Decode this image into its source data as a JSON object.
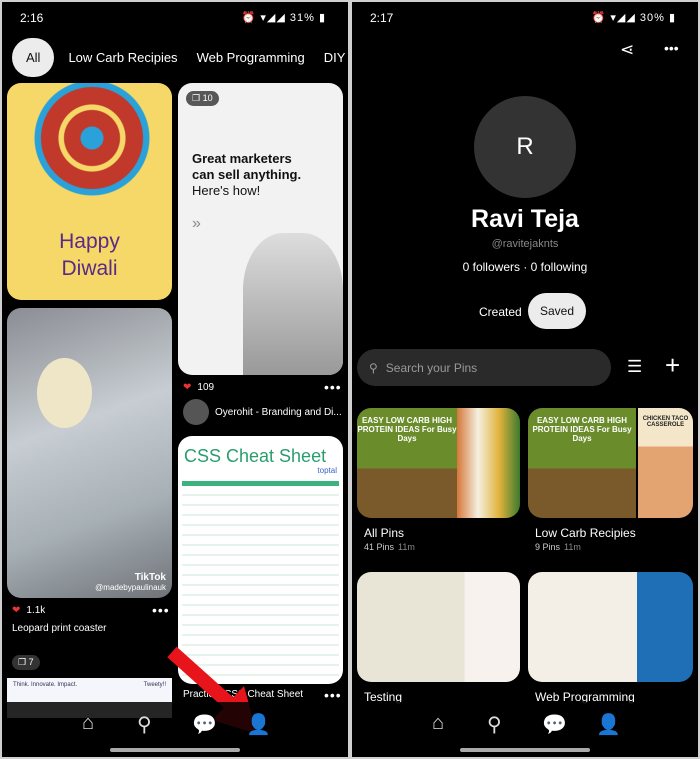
{
  "left": {
    "status": {
      "time": "2:16",
      "battery": "31%"
    },
    "chips": [
      "All",
      "Low Carb Recipies",
      "Web Programming",
      "DIY Pins"
    ],
    "pins": {
      "diwali": {
        "text1": "Happy",
        "text2": "Diwali"
      },
      "marketing": {
        "badge": "10",
        "line1": "Great marketers",
        "line2": "can sell anything.",
        "line3": "Here's how!",
        "arrows": "»",
        "likes": "109",
        "author": "Oyerohit - Branding and Di..."
      },
      "tiktok": {
        "watermark": "TikTok",
        "handle": "@madebypaulinauk",
        "likes": "1.1k",
        "title": "Leopard print coaster"
      },
      "css": {
        "title": "CSS Cheat Sheet",
        "brand": "toptal",
        "caption": "Practical CSS Cheat Sheet"
      },
      "fourth": {
        "badge": "7",
        "text1": "Think. Innovate. Impact.",
        "text2": "Tweety!!"
      }
    },
    "annotation_color": "#e8141b"
  },
  "right": {
    "status": {
      "time": "2:17",
      "battery": "30%"
    },
    "profile": {
      "initial": "R",
      "name": "Ravi Teja",
      "handle": "@ravitejaknts",
      "stats": "0 followers · 0 following"
    },
    "tabs": [
      "Created",
      "Saved"
    ],
    "search_placeholder": "Search your Pins",
    "boards": [
      {
        "name": "All Pins",
        "pins": "41 Pins",
        "time": "11m",
        "cover": "EASY LOW CARB HIGH PROTEIN IDEAS For Busy Days"
      },
      {
        "name": "Low Carb Recipies",
        "pins": "9 Pins",
        "time": "11m",
        "cover": "EASY LOW CARB HIGH PROTEIN IDEAS For Busy Days",
        "side": "CHICKEN TACO CASSEROLE"
      },
      {
        "name": "Testing"
      },
      {
        "name": "Web Programming"
      }
    ]
  }
}
